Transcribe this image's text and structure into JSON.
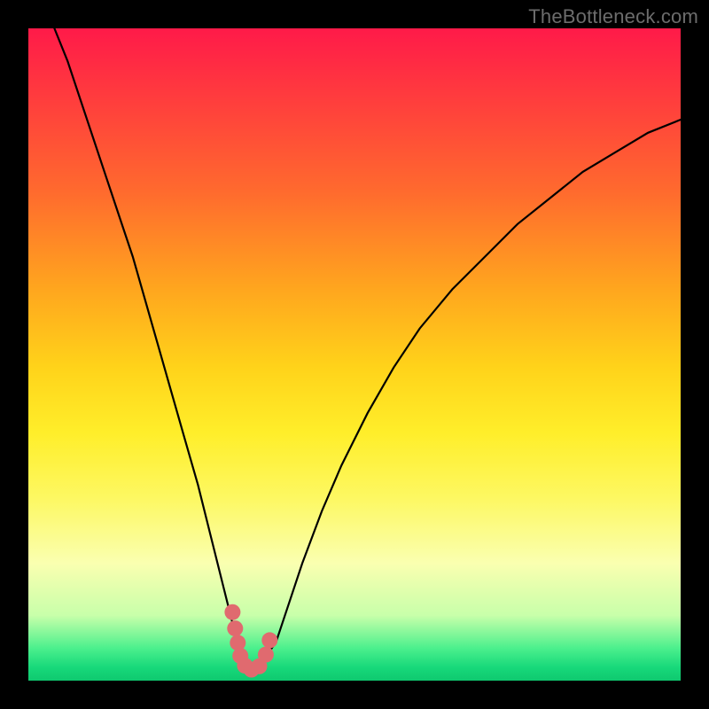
{
  "watermark": "TheBottleneck.com",
  "chart_data": {
    "type": "line",
    "title": "",
    "xlabel": "",
    "ylabel": "",
    "xlim": [
      0,
      100
    ],
    "ylim": [
      0,
      100
    ],
    "series": [
      {
        "name": "bottleneck-curve",
        "x": [
          4,
          6,
          8,
          10,
          12,
          14,
          16,
          18,
          20,
          22,
          24,
          26,
          28,
          30,
          32,
          33,
          34,
          35,
          36,
          38,
          40,
          42,
          45,
          48,
          52,
          56,
          60,
          65,
          70,
          75,
          80,
          85,
          90,
          95,
          100
        ],
        "y": [
          100,
          95,
          89,
          83,
          77,
          71,
          65,
          58,
          51,
          44,
          37,
          30,
          22,
          14,
          6,
          3,
          2,
          2,
          3,
          6,
          12,
          18,
          26,
          33,
          41,
          48,
          54,
          60,
          65,
          70,
          74,
          78,
          81,
          84,
          86
        ]
      }
    ],
    "highlights": {
      "name": "salmon-dots",
      "x": [
        31.3,
        31.7,
        32.1,
        32.5,
        33.2,
        34.2,
        35.4,
        36.4,
        37.0
      ],
      "y": [
        10.5,
        8.0,
        5.8,
        3.8,
        2.3,
        1.7,
        2.2,
        4.0,
        6.2
      ]
    },
    "gradient_colors": {
      "top": "#ff1a49",
      "mid": "#ffee2a",
      "bottom": "#17d87a"
    }
  }
}
